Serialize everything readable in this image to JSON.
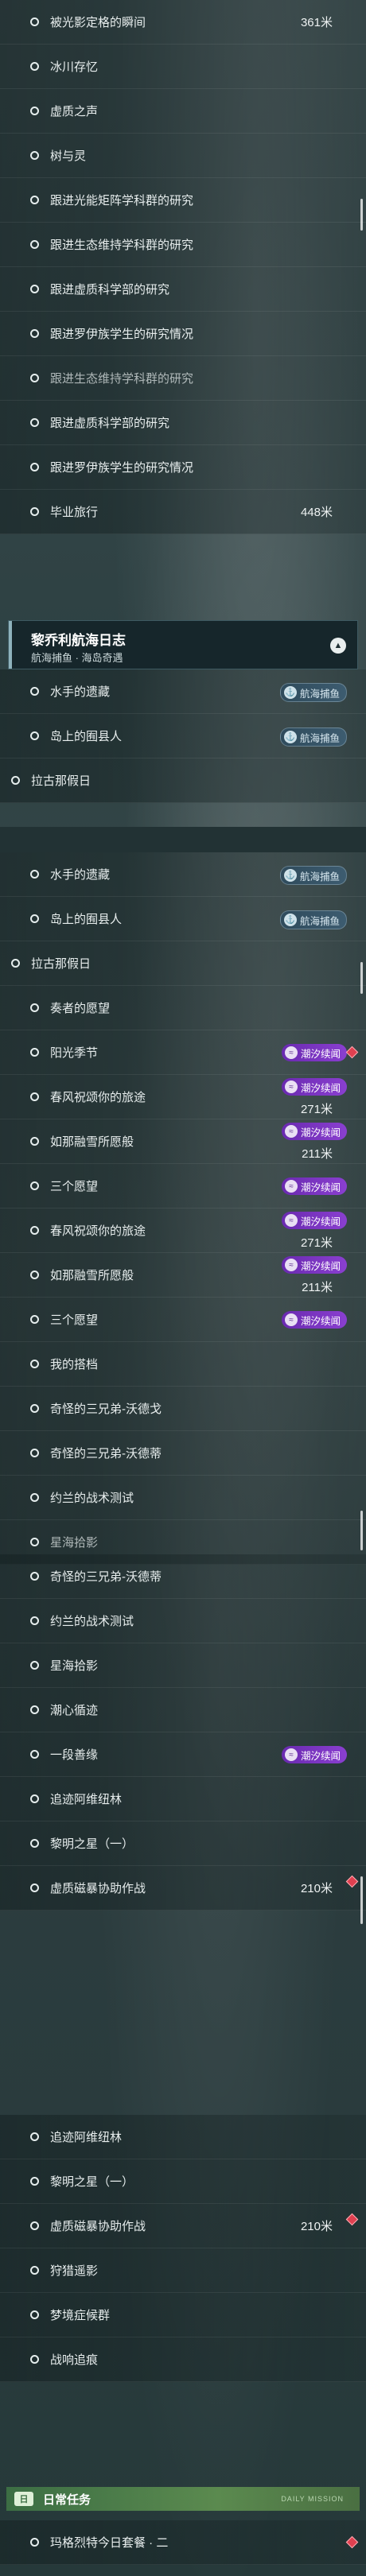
{
  "panels": [
    [
      {
        "label": "被光影定格的瞬间",
        "dist": "361米",
        "sub": true
      },
      {
        "label": "冰川存忆",
        "sub": true
      },
      {
        "label": "虚质之声",
        "sub": true
      },
      {
        "label": "树与灵",
        "sub": true
      },
      {
        "label": "跟进光能矩阵学科群的研究",
        "sub": true
      },
      {
        "label": "跟进生态维持学科群的研究",
        "sub": true
      },
      {
        "label": "跟进虚质科学部的研究",
        "sub": true
      },
      {
        "label": "跟进罗伊族学生的研究情况",
        "sub": true
      },
      {
        "label": "跟进生态维持学科群的研究",
        "sub": true,
        "cut": true
      },
      {
        "label": "跟进虚质科学部的研究",
        "sub": true
      },
      {
        "label": "跟进罗伊族学生的研究情况",
        "sub": true
      },
      {
        "label": "毕业旅行",
        "dist": "448米",
        "sub": true
      }
    ],
    [
      {
        "label": "水手的遗藏",
        "sub": true,
        "badge": "航海捕鱼",
        "btype": "nav"
      },
      {
        "label": "岛上的囿县人",
        "sub": true,
        "badge": "航海捕鱼",
        "btype": "nav"
      },
      {
        "label": "拉古那假日",
        "sub": false
      }
    ],
    [
      {
        "label": "水手的遗藏",
        "sub": true,
        "badge": "航海捕鱼",
        "btype": "nav"
      },
      {
        "label": "岛上的囿县人",
        "sub": true,
        "badge": "航海捕鱼",
        "btype": "nav"
      },
      {
        "label": "拉古那假日",
        "sub": false
      },
      {
        "label": "奏者的愿望",
        "sub": true
      },
      {
        "label": "阳光季节",
        "sub": true,
        "badge": "潮汐续闻",
        "btype": "purple",
        "diamond": true
      },
      {
        "label": "春风祝颂你的旅途",
        "sub": true,
        "badge": "潮汐续闻",
        "btype": "purple",
        "dist": "271米"
      },
      {
        "label": "如那融雪所愿般",
        "sub": true,
        "badge": "潮汐续闻",
        "btype": "purple",
        "dist": "211米"
      },
      {
        "label": "三个愿望",
        "sub": true,
        "badge": "潮汐续闻",
        "btype": "purple"
      },
      {
        "label": "春风祝颂你的旅途",
        "sub": true,
        "badge": "潮汐续闻",
        "btype": "purple",
        "dist": "271米"
      },
      {
        "label": "如那融雪所愿般",
        "sub": true,
        "badge": "潮汐续闻",
        "btype": "purple",
        "dist": "211米"
      },
      {
        "label": "三个愿望",
        "sub": true,
        "badge": "潮汐续闻",
        "btype": "purple"
      },
      {
        "label": "我的搭档",
        "sub": true
      },
      {
        "label": "奇怪的三兄弟-沃德戈",
        "sub": true
      },
      {
        "label": "奇怪的三兄弟-沃德蒂",
        "sub": true
      },
      {
        "label": "约兰的战术测试",
        "sub": true
      },
      {
        "label": "星海拾影",
        "sub": true,
        "cut": true
      }
    ],
    [
      {
        "label": "奇怪的三兄弟-沃德蒂",
        "sub": true
      },
      {
        "label": "约兰的战术测试",
        "sub": true
      },
      {
        "label": "星海拾影",
        "sub": true
      },
      {
        "label": "潮心循迹",
        "sub": true
      },
      {
        "label": "一段善缘",
        "sub": true,
        "badge": "潮汐续闻",
        "btype": "purple"
      },
      {
        "label": "追迹阿维纽林",
        "sub": true
      },
      {
        "label": "黎明之星（一）",
        "sub": true
      },
      {
        "label": "虚质磁暴协助作战",
        "sub": true,
        "dist": "210米",
        "diamond": true
      }
    ],
    [
      {
        "label": "追迹阿维纽林",
        "sub": true
      },
      {
        "label": "黎明之星（一）",
        "sub": true
      },
      {
        "label": "虚质磁暴协助作战",
        "sub": true,
        "dist": "210米",
        "diamond": true
      },
      {
        "label": "狩猎遥影",
        "sub": true
      },
      {
        "label": "梦境症候群",
        "sub": true
      },
      {
        "label": "战响追痕",
        "sub": true
      }
    ]
  ],
  "header": {
    "title": "黎乔利航海日志",
    "subtitle": "航海捕鱼 · 海岛奇遇"
  },
  "daily": {
    "icon": "日",
    "title": "日常任务",
    "item": "玛格烈特今日套餐 · 二",
    "tag": "DAILY MISSION"
  }
}
